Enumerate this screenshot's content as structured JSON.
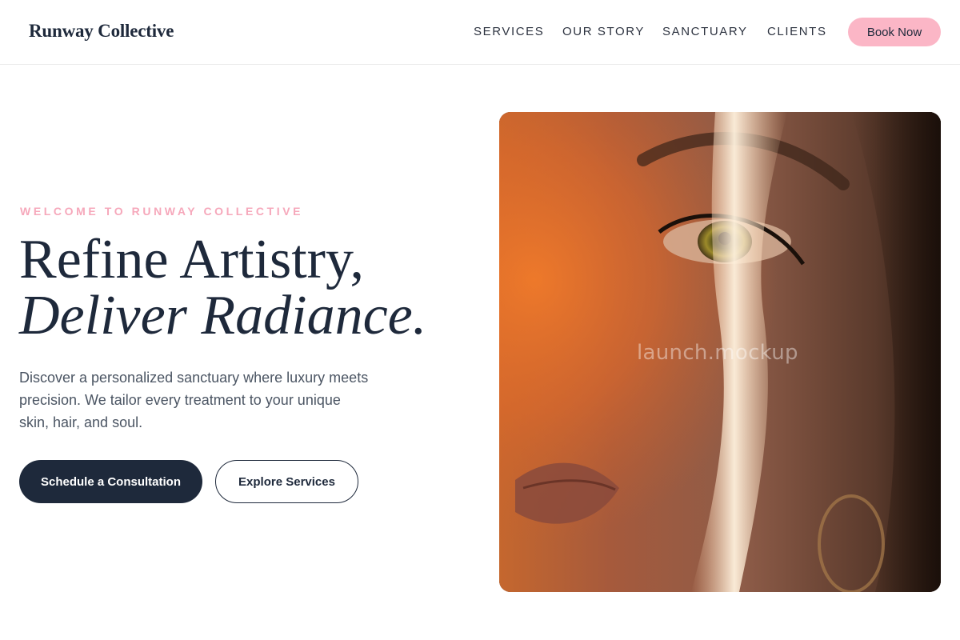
{
  "header": {
    "logo": "Runway Collective",
    "nav": [
      "SERVICES",
      "OUR STORY",
      "SANCTUARY",
      "CLIENTS"
    ],
    "cta_label": "Book Now"
  },
  "hero": {
    "eyebrow": "WELCOME TO RUNWAY COLLECTIVE",
    "headline_line1": "Refine Artistry,",
    "headline_line2": "Deliver Radiance.",
    "description": "Discover a personalized sanctuary where luxury meets precision. We tailor every treatment to your unique skin, hair, and soul.",
    "primary_button": "Schedule a Consultation",
    "secondary_button": "Explore Services",
    "image_watermark": "launch.mockup"
  },
  "colors": {
    "brand_navy": "#1e293b",
    "accent_pink": "#fbb6c6",
    "eyebrow_pink": "#f6a8bb",
    "body_text": "#4b5563"
  }
}
